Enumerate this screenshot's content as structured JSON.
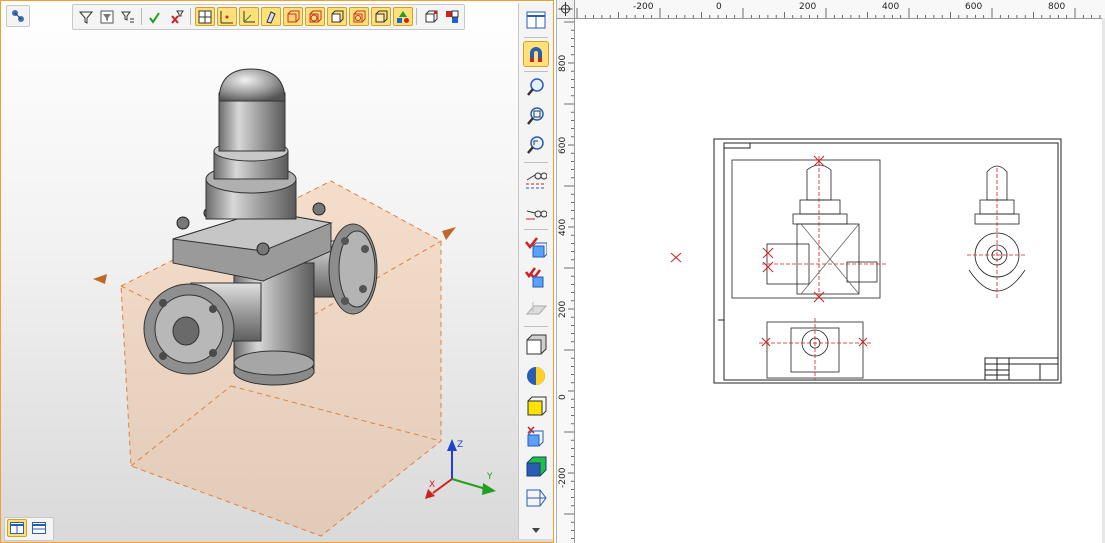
{
  "window": {
    "accent_color": "#f0a030",
    "active_tool_color": "#ffe07a"
  },
  "toolbar_3d": {
    "buttons": [
      {
        "name": "tree-view-icon"
      },
      {
        "name": "filter-icon"
      },
      {
        "name": "filter-sheet-icon"
      },
      {
        "name": "filter-list-icon"
      },
      {
        "name": "check-filter-icon"
      },
      {
        "name": "cross-filter-icon"
      },
      {
        "name": "workplane-icon",
        "active": true
      },
      {
        "name": "point-snap-icon",
        "active": true
      },
      {
        "name": "axis-icon",
        "active": true
      },
      {
        "name": "edge-icon",
        "active": true
      },
      {
        "name": "face-icon",
        "active": true
      },
      {
        "name": "body-icon",
        "active": true
      },
      {
        "name": "solid-icon",
        "active": true
      },
      {
        "name": "surface-icon",
        "active": true
      },
      {
        "name": "shell-icon",
        "active": true
      },
      {
        "name": "shapes-icon",
        "active": true
      },
      {
        "name": "view-cube-icon"
      },
      {
        "name": "assembly-colors-icon"
      }
    ]
  },
  "view_toggle": {
    "buttons": [
      {
        "name": "layout-split-icon",
        "active": true
      },
      {
        "name": "layout-single-icon",
        "active": false
      }
    ]
  },
  "vertical_toolbar": {
    "buttons": [
      {
        "name": "window-icon"
      },
      {
        "name": "magnet-icon",
        "active": true
      },
      {
        "name": "zoom-icon"
      },
      {
        "name": "zoom-window-icon"
      },
      {
        "name": "zoom-fit-icon"
      },
      {
        "name": "view-glasses-icon"
      },
      {
        "name": "view-glasses-alt-icon"
      },
      {
        "name": "check-cube-icon"
      },
      {
        "name": "double-check-cube-icon"
      },
      {
        "name": "transparent-plane-icon"
      },
      {
        "name": "wireframe-cube-icon"
      },
      {
        "name": "sphere-shading-icon"
      },
      {
        "name": "yellow-face-icon"
      },
      {
        "name": "section-cube-icon"
      },
      {
        "name": "green-cube-icon"
      },
      {
        "name": "projection-icon"
      }
    ]
  },
  "axes": {
    "x": "X",
    "y": "Y",
    "z": "Z"
  },
  "ruler_top": {
    "labels": [
      "-200",
      "0",
      "200",
      "400",
      "600",
      "800"
    ]
  },
  "ruler_left": {
    "labels": [
      "800",
      "600",
      "400",
      "200",
      "0",
      "-200"
    ]
  }
}
